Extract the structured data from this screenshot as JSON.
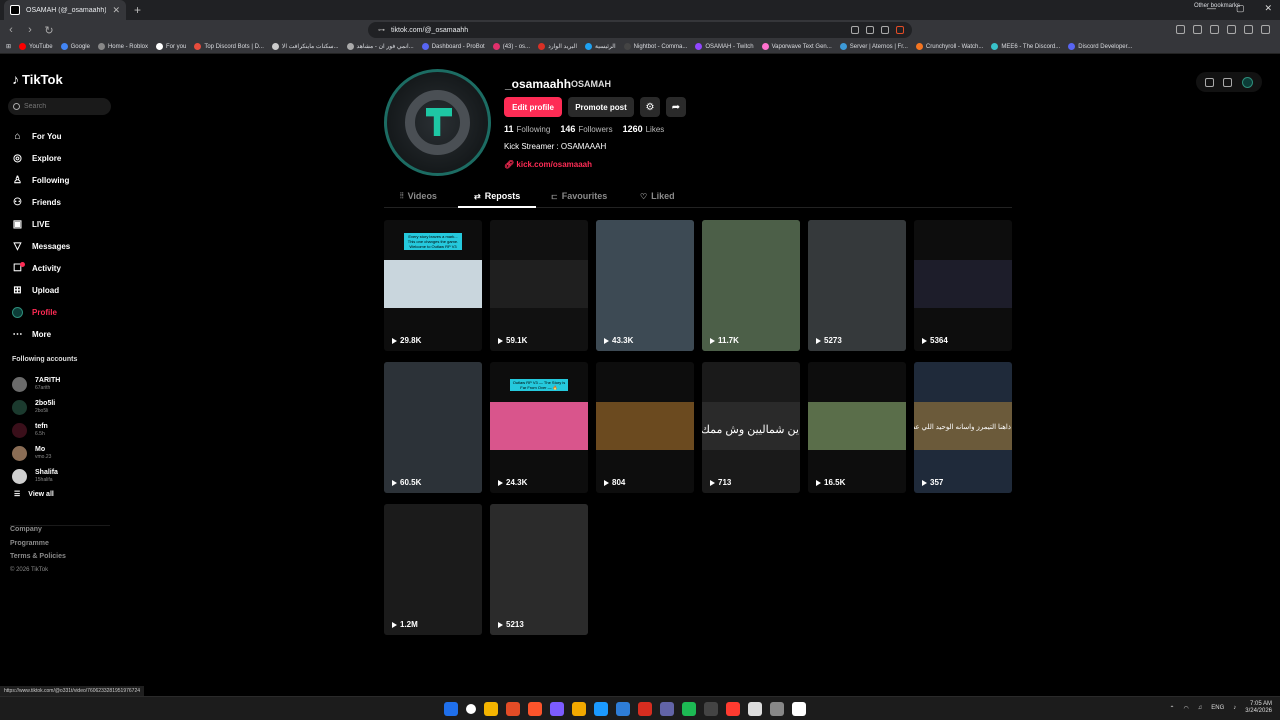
{
  "browser": {
    "tab_title": "OSAMAH (@_osamaahh) | TikTok",
    "url": "tiktok.com/@_osamaahh",
    "status_url": "https://www.tiktok.com/@o331t/video/7606233281951976724",
    "bookmarks": [
      {
        "label": "YouTube",
        "color": "#ff0000"
      },
      {
        "label": "Google",
        "color": "#4285f4"
      },
      {
        "label": "Home - Roblox",
        "color": "#888888"
      },
      {
        "label": "For you",
        "color": "#ffffff"
      },
      {
        "label": "Top Discord Bots | D...",
        "color": "#e74c3c"
      },
      {
        "label": "سكنات ماينكرافت الا...",
        "color": "#cccccc"
      },
      {
        "label": "انمي فور ان - مشاهد...",
        "color": "#aaaaaa"
      },
      {
        "label": "Dashboard - ProBot",
        "color": "#5865f2"
      },
      {
        "label": "(43) - os...",
        "color": "#e1306c"
      },
      {
        "label": "البريد الوارد",
        "color": "#d93025"
      },
      {
        "label": "الرئيسية",
        "color": "#1da1f2"
      },
      {
        "label": "Nightbot - Comma...",
        "color": "#444444"
      },
      {
        "label": "OSAMAH - Twitch",
        "color": "#9146ff"
      },
      {
        "label": "Vaporwave Text Gen...",
        "color": "#ff71ce"
      },
      {
        "label": "Server | Aternos | Fr...",
        "color": "#3d9ad8"
      },
      {
        "label": "Crunchyroll - Watch...",
        "color": "#f47521"
      },
      {
        "label": "MEE6 - The Discord...",
        "color": "#38c2c9"
      },
      {
        "label": "Discord Developer...",
        "color": "#5865f2"
      }
    ],
    "other_bookmarks": "Other bookmarks"
  },
  "sidebar": {
    "logo": "TikTok",
    "search_placeholder": "Search",
    "nav": [
      {
        "label": "For You",
        "icon": "home-icon",
        "glyph": "⌂"
      },
      {
        "label": "Explore",
        "icon": "compass-icon",
        "glyph": "◎"
      },
      {
        "label": "Following",
        "icon": "following-icon",
        "glyph": "♙"
      },
      {
        "label": "Friends",
        "icon": "friends-icon",
        "glyph": "⚇"
      },
      {
        "label": "LIVE",
        "icon": "live-icon",
        "glyph": "▣"
      },
      {
        "label": "Messages",
        "icon": "messages-icon",
        "glyph": "▽"
      },
      {
        "label": "Activity",
        "icon": "activity-icon",
        "glyph": "☐"
      },
      {
        "label": "Upload",
        "icon": "upload-icon",
        "glyph": "⊞"
      },
      {
        "label": "Profile",
        "icon": "profile-icon",
        "glyph": ""
      },
      {
        "label": "More",
        "icon": "more-icon",
        "glyph": "⋯"
      }
    ],
    "following_title": "Following accounts",
    "accounts": [
      {
        "name": "7ARITH",
        "handle": "67arith",
        "color": "#6b6b6b"
      },
      {
        "name": "2bo5li",
        "handle": "2bo5li",
        "color": "#1b3a2e"
      },
      {
        "name": "tefn",
        "handle": "6.5h",
        "color": "#3a0f1a"
      },
      {
        "name": "Mo",
        "handle": "vmo.23",
        "color": "#8a6d55"
      },
      {
        "name": "Shalifa",
        "handle": "15halifa",
        "color": "#cfcfcf"
      }
    ],
    "view_all": "View all",
    "footer": [
      "Company",
      "Programme",
      "Terms & Policies"
    ],
    "copyright": "© 2026 TikTok"
  },
  "profile": {
    "username": "_osamaahh",
    "display_name": "OSAMAH",
    "edit_button": "Edit profile",
    "promote_button": "Promote post",
    "following_count": "11",
    "following_label": "Following",
    "followers_count": "146",
    "followers_label": "Followers",
    "likes_count": "1260",
    "likes_label": "Likes",
    "bio": "Kick Streamer : OSAMAAAH",
    "link": "kick.com/osamaaah"
  },
  "tabs": [
    {
      "label": "Videos",
      "icon": "grid-icon",
      "glyph": "⦙⦙"
    },
    {
      "label": "Reposts",
      "icon": "repost-icon",
      "glyph": "⇄"
    },
    {
      "label": "Favourites",
      "icon": "bookmark-icon",
      "glyph": "⊏"
    },
    {
      "label": "Liked",
      "icon": "heart-icon",
      "glyph": "♡"
    }
  ],
  "videos": [
    {
      "views": "29.8K",
      "caption": "Every story leaves a mark... This one changes the game. Welcome to Outlaw RP V3",
      "bg": "#0d0d0d",
      "img": "#c9d6dd"
    },
    {
      "views": "59.1K",
      "caption": "",
      "bg": "#111111",
      "img": "#1f1f1f"
    },
    {
      "views": "43.3K",
      "caption": "",
      "bg": "#2b3036",
      "img": "#3d4a54"
    },
    {
      "views": "11.7K",
      "caption": "",
      "bg": "#2c3a2e",
      "img": "#4c5f48"
    },
    {
      "views": "5273",
      "caption": "",
      "bg": "#24282a",
      "img": "#35393b"
    },
    {
      "views": "5364",
      "caption": "",
      "bg": "#0d0d0d",
      "img": "#1d1d2a"
    },
    {
      "views": "60.5K",
      "caption": "",
      "bg": "#1a1d20",
      "img": "#2c3238"
    },
    {
      "views": "24.3K",
      "caption": "Outlaw RP V3 — The Story is Far From Over — 🔥",
      "bg": "#0d0d0d",
      "img": "#d9558c"
    },
    {
      "views": "804",
      "caption": "",
      "bg": "#0d0d0d",
      "img": "#6b4a1f"
    },
    {
      "views": "713",
      "caption": "ين شماليين وش ممك",
      "bg": "#1a1a1a",
      "img": "#2a2a2a"
    },
    {
      "views": "16.5K",
      "caption": "",
      "bg": "#0d0d0d",
      "img": "#5a6e4a"
    },
    {
      "views": "357",
      "caption": "ذاهنا التيمرز واسانه الوحيد اللي عطانا وجه",
      "bg": "#1f2a3a",
      "img": "#6b5a3a"
    },
    {
      "views": "1.2M",
      "caption": "",
      "bg": "#121212",
      "img": "#1b1b1b"
    },
    {
      "views": "5213",
      "caption": "",
      "bg": "#1c1c1c",
      "img": "#2b2b2b"
    }
  ],
  "taskbar": {
    "lang": "ENG",
    "time": "7:05 AM",
    "date": "3/24/2026",
    "apps": [
      "#1f6feb",
      "#ffffff",
      "#f4b400",
      "#e34c26",
      "#fb542b",
      "#7c5cff",
      "#f2a900",
      "#1b9aff",
      "#2e7dd7",
      "#d62d20",
      "#6264a7",
      "#1db954",
      "#444444",
      "#ff3b30",
      "#dddddd",
      "#888888",
      "#ffffff"
    ]
  },
  "colors": {
    "accent": "#fe2c55",
    "teal": "#1ec7a4"
  }
}
